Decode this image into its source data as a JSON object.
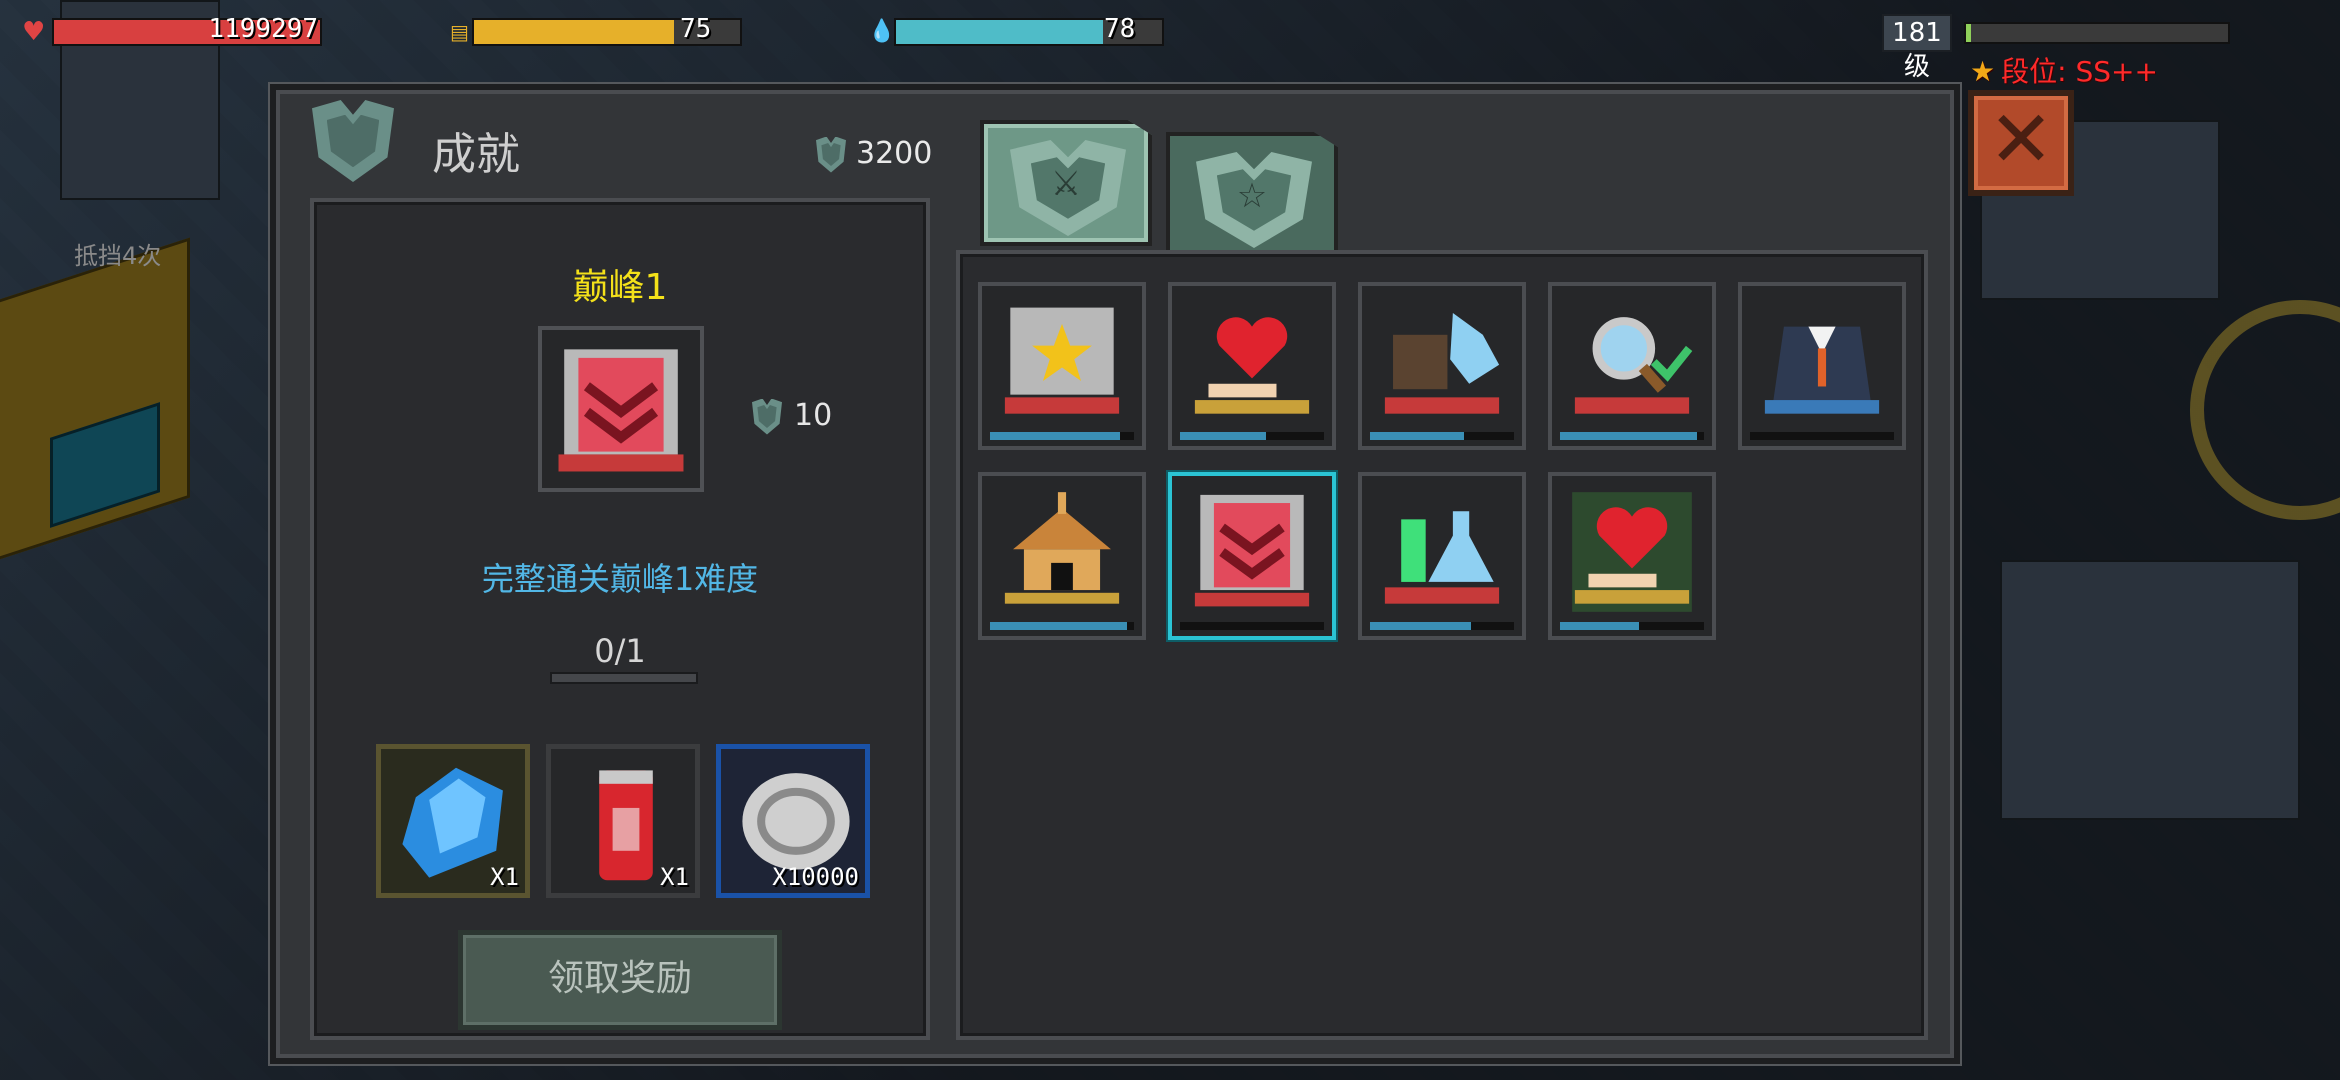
{
  "hud": {
    "hp": {
      "value": "1199297",
      "fill": 1.0,
      "color": "#d84040"
    },
    "energy": {
      "value": "75",
      "fill": 0.75,
      "color": "#e6b02a"
    },
    "mana": {
      "value": "78",
      "fill": 0.78,
      "color": "#4fbcc8"
    },
    "level": "181级",
    "level_fill": 0.02,
    "rank": "段位: SS++"
  },
  "background": {
    "hint_text": "抵挡4次"
  },
  "panel": {
    "title": "成就",
    "points": "3200",
    "tabs": [
      {
        "label": "",
        "icon": "sword-shield-icon",
        "active": true
      },
      {
        "label": "",
        "icon": "star-shield-icon",
        "active": false
      }
    ],
    "close_icon": "close-icon",
    "close_glyph": "✕"
  },
  "detail": {
    "name": "巅峰1",
    "reward_points": "10",
    "description": "完整通关巅峰1难度",
    "progress_text": "0/1",
    "progress_fill": 0,
    "rewards": [
      {
        "icon": "blue-gem-icon",
        "qty": "X1"
      },
      {
        "icon": "cola-can-icon",
        "qty": "X1"
      },
      {
        "icon": "silver-coin-icon",
        "qty": "X10000"
      }
    ],
    "claim_label": "领取奖励"
  },
  "achievements": [
    {
      "icon": "eagle-star-badge-icon",
      "progress": 0.9,
      "selected": false
    },
    {
      "icon": "heart-hand-badge-icon",
      "progress": 0.6,
      "selected": false
    },
    {
      "icon": "boot-badge-icon",
      "progress": 0.65,
      "selected": false
    },
    {
      "icon": "magnifier-check-badge-icon",
      "progress": 0.95,
      "selected": false
    },
    {
      "icon": "suit-badge-icon",
      "progress": 0,
      "selected": false
    },
    {
      "icon": "church-badge-icon",
      "progress": 0.95,
      "selected": false
    },
    {
      "icon": "peak-chevron-badge-icon",
      "progress": 0,
      "selected": true
    },
    {
      "icon": "potion-badge-icon",
      "progress": 0.7,
      "selected": false
    },
    {
      "icon": "heart-hand-green-badge-icon",
      "progress": 0.55,
      "selected": false
    }
  ]
}
